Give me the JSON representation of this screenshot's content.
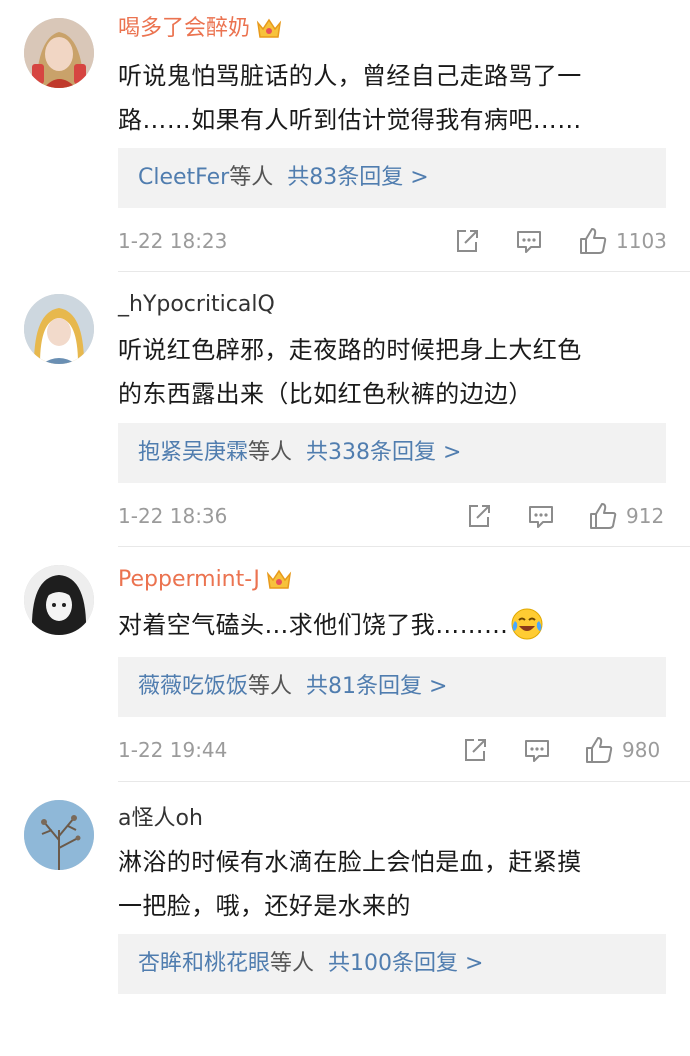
{
  "comments": [
    {
      "username": "喝多了会醉奶",
      "text_lines": [
        "听说鬼怕骂脏话的人，曾经自己走路骂了一",
        "路……如果有人听到估计觉得我有病吧……"
      ],
      "reply_users": "CleetFer",
      "reply_suffix": "等人",
      "reply_count": "共83条回复 >",
      "time": "1-22 18:23",
      "likes": "1103"
    },
    {
      "username": "_hYpocriticalQ",
      "text_lines": [
        "听说红色辟邪，走夜路的时候把身上大红色",
        "的东西露出来（比如红色秋裤的边边）"
      ],
      "reply_users": "抱紧吴庚霖",
      "reply_suffix": "等人",
      "reply_count": "共338条回复 >",
      "time": "1-22 18:36",
      "likes": "912"
    },
    {
      "username": "Peppermint-J",
      "text_lines": [
        "对着空气磕头…求他们饶了我………"
      ],
      "reply_users": "薇薇吃饭饭",
      "reply_suffix": "等人",
      "reply_count": "共81条回复 >",
      "time": "1-22 19:44",
      "likes": "980"
    },
    {
      "username": "a怪人oh",
      "text_lines": [
        "淋浴的时候有水滴在脸上会怕是血，赶紧摸",
        "一把脸，哦，还好是水来的"
      ],
      "reply_users": "杏眸和桃花眼",
      "reply_suffix": "等人",
      "reply_count": "共100条回复 >",
      "time": "",
      "likes": ""
    }
  ],
  "icons": {
    "share": "share-icon",
    "comment": "comment-icon",
    "like": "thumbs-up-icon",
    "vip": "crown-icon",
    "emoji": "crying-laughing-emoji-icon"
  },
  "colors": {
    "vip_name": "#eb7350",
    "link": "#507daf",
    "meta": "#9b9b9b",
    "reply_bg": "#f2f2f2"
  }
}
